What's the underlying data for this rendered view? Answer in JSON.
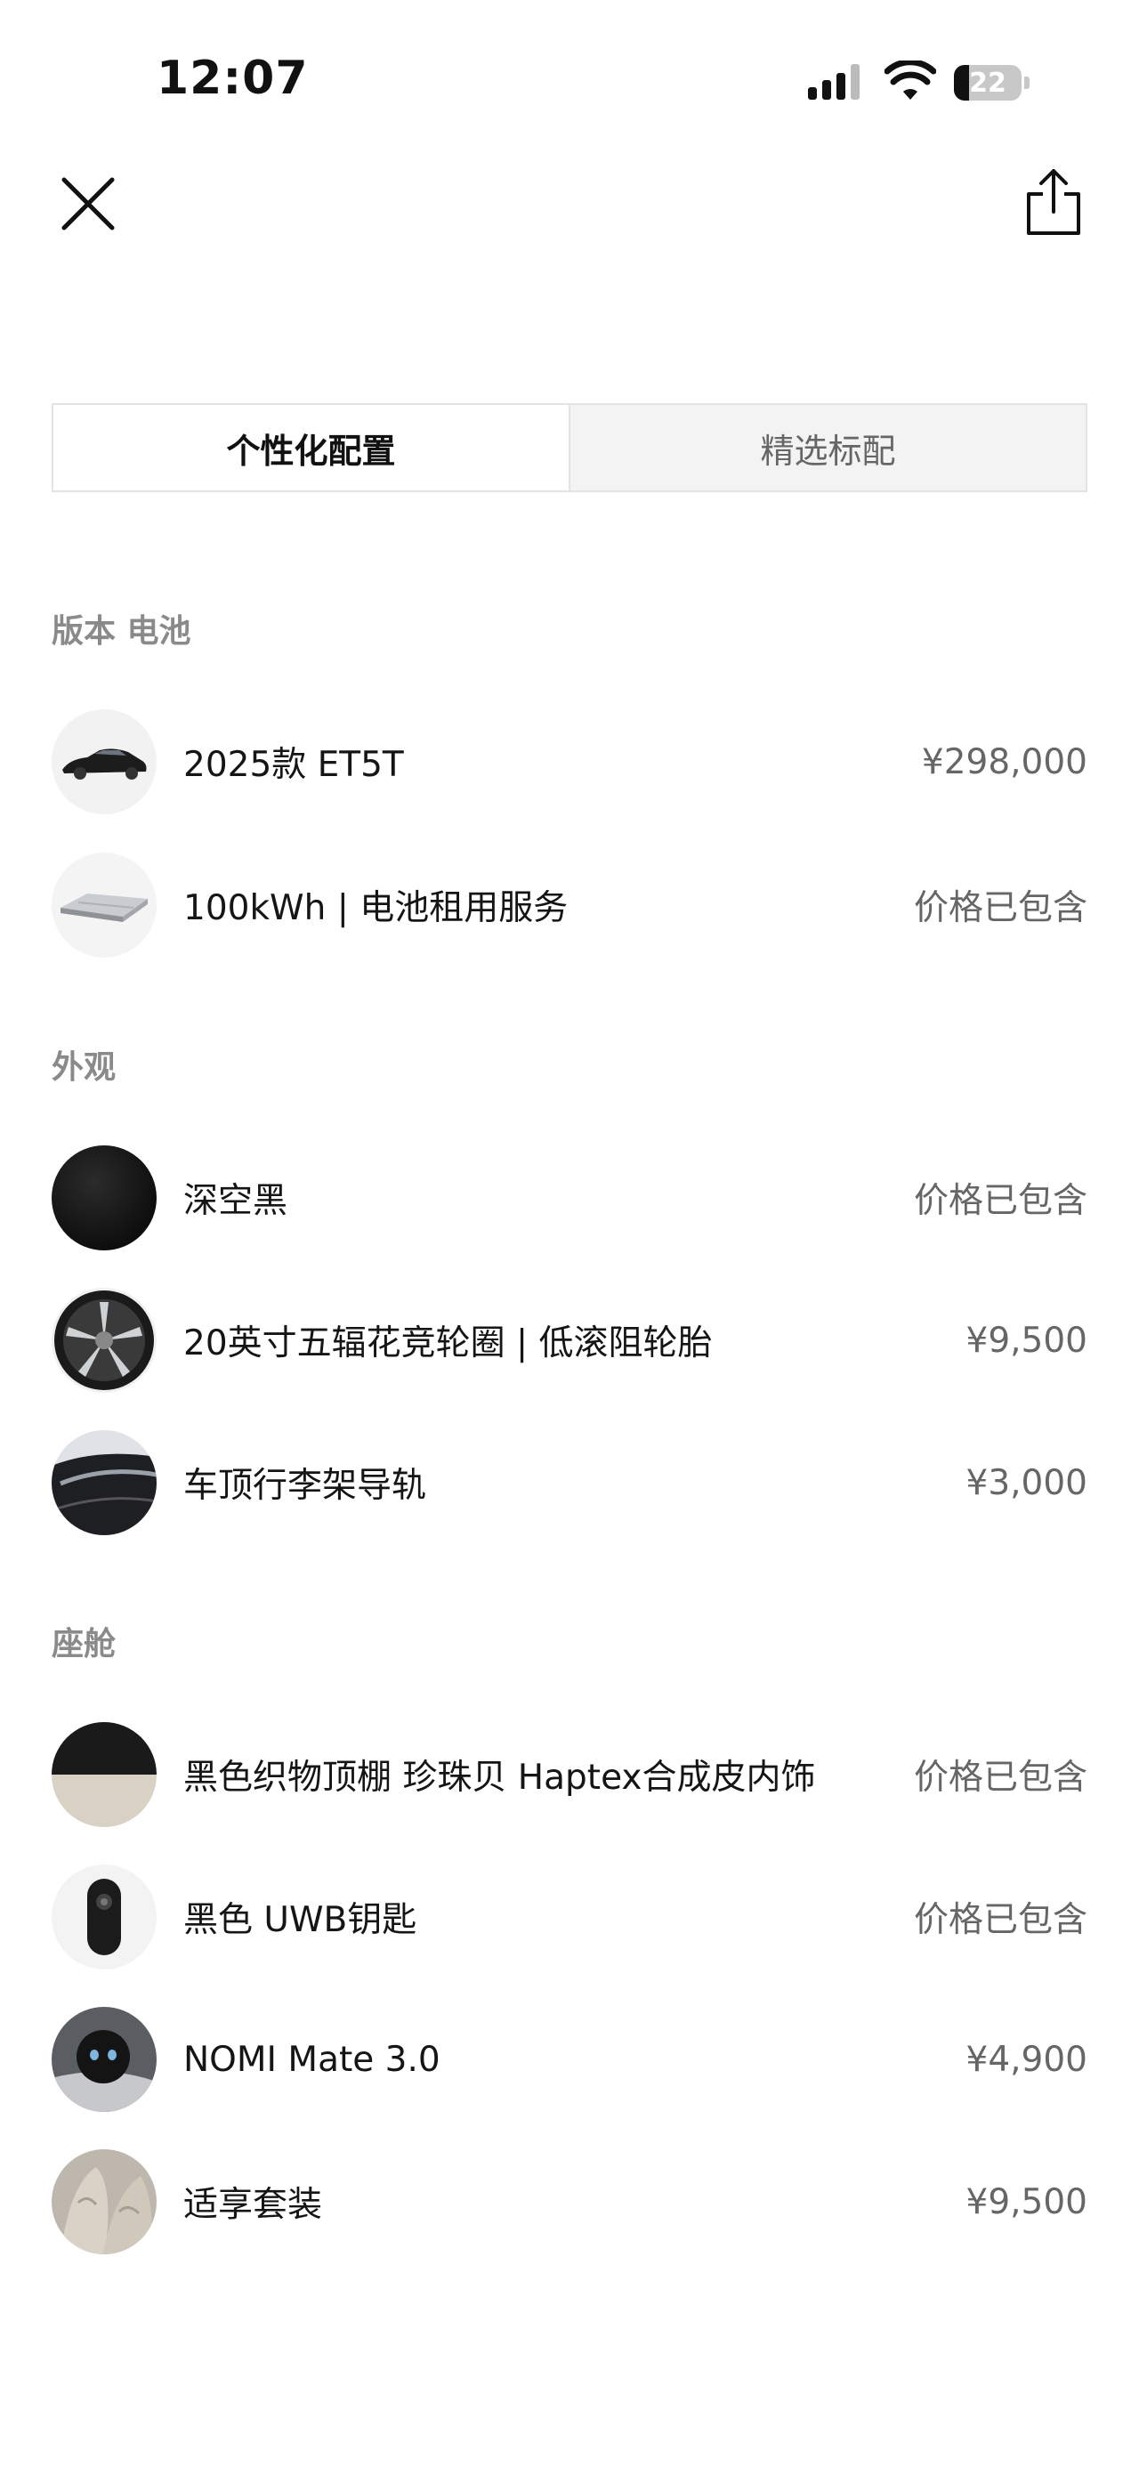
{
  "status_bar": {
    "time": "12:07",
    "battery_level": "22"
  },
  "header": {
    "close_icon": "close-icon",
    "share_icon": "share-icon"
  },
  "tabs": [
    {
      "label": "个性化配置",
      "active": true
    },
    {
      "label": "精选标配",
      "active": false
    }
  ],
  "sections": [
    {
      "title": "版本 电池",
      "items": [
        {
          "label": "2025款 ET5T",
          "price": "¥298,000",
          "thumb": "car"
        },
        {
          "label": "100kWh | 电池租用服务",
          "price": "价格已包含",
          "thumb": "battery"
        }
      ]
    },
    {
      "title": "外观",
      "items": [
        {
          "label": "深空黑",
          "price": "价格已包含",
          "thumb": "paint-black"
        },
        {
          "label": "20英寸五辐花竞轮圈 | 低滚阻轮胎",
          "price": "¥9,500",
          "thumb": "wheel"
        },
        {
          "label": "车顶行李架导轨",
          "price": "¥3,000",
          "thumb": "roof-rail"
        }
      ]
    },
    {
      "title": "座舱",
      "items": [
        {
          "label": "黑色织物顶棚 珍珠贝 Haptex合成皮内饰",
          "price": "价格已包含",
          "thumb": "interior"
        },
        {
          "label": "黑色 UWB钥匙",
          "price": "价格已包含",
          "thumb": "key"
        },
        {
          "label": "NOMI Mate 3.0",
          "price": "¥4,900",
          "thumb": "nomi"
        },
        {
          "label": "适享套装",
          "price": "¥9,500",
          "thumb": "seat"
        }
      ]
    }
  ]
}
